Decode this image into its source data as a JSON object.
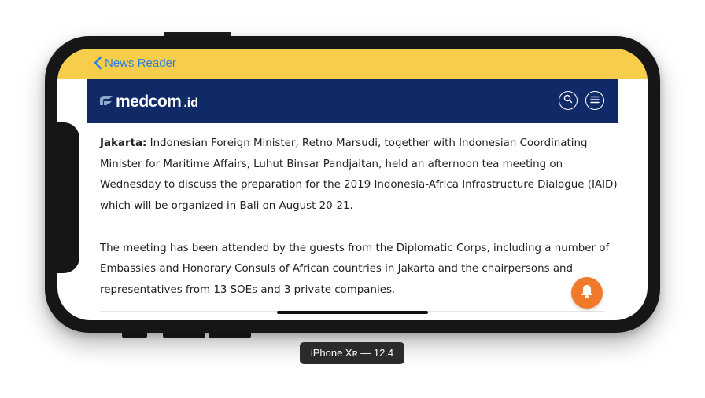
{
  "navbar": {
    "back_label": "News Reader"
  },
  "site": {
    "logo_main": "medcom",
    "logo_tld": ".id",
    "brand_color": "#0f2a66"
  },
  "article": {
    "p1_lead": "Jakarta:",
    "p1_text": " Indonesian Foreign Minister, Retno Marsudi, together with Indonesian Coordinating Minister for Maritime Affairs, Luhut Binsar Pandjaitan, held an afternoon tea meeting on Wednesday to discuss the preparation for the  2019 Indonesia-Africa Infrastructure Dialogue (IAID) which will be organized in Bali on August 20-21.",
    "p2_text": "The meeting has been attended by the guests from the Diplomatic Corps, including a number of Embassies and Honorary Consuls of African countries in Jakarta and the chairpersons and representatives from 13 SOEs and 3 private companies."
  },
  "icons": {
    "back": "chevron-left-icon",
    "search": "search-icon",
    "menu": "hamburger-menu-icon",
    "notification": "bell-icon"
  },
  "colors": {
    "navbar": "#f7ce4c",
    "back_link": "#2f7fe0",
    "fab": "#f07a2a"
  },
  "device": {
    "label": "iPhone Xʀ — 12.4"
  }
}
